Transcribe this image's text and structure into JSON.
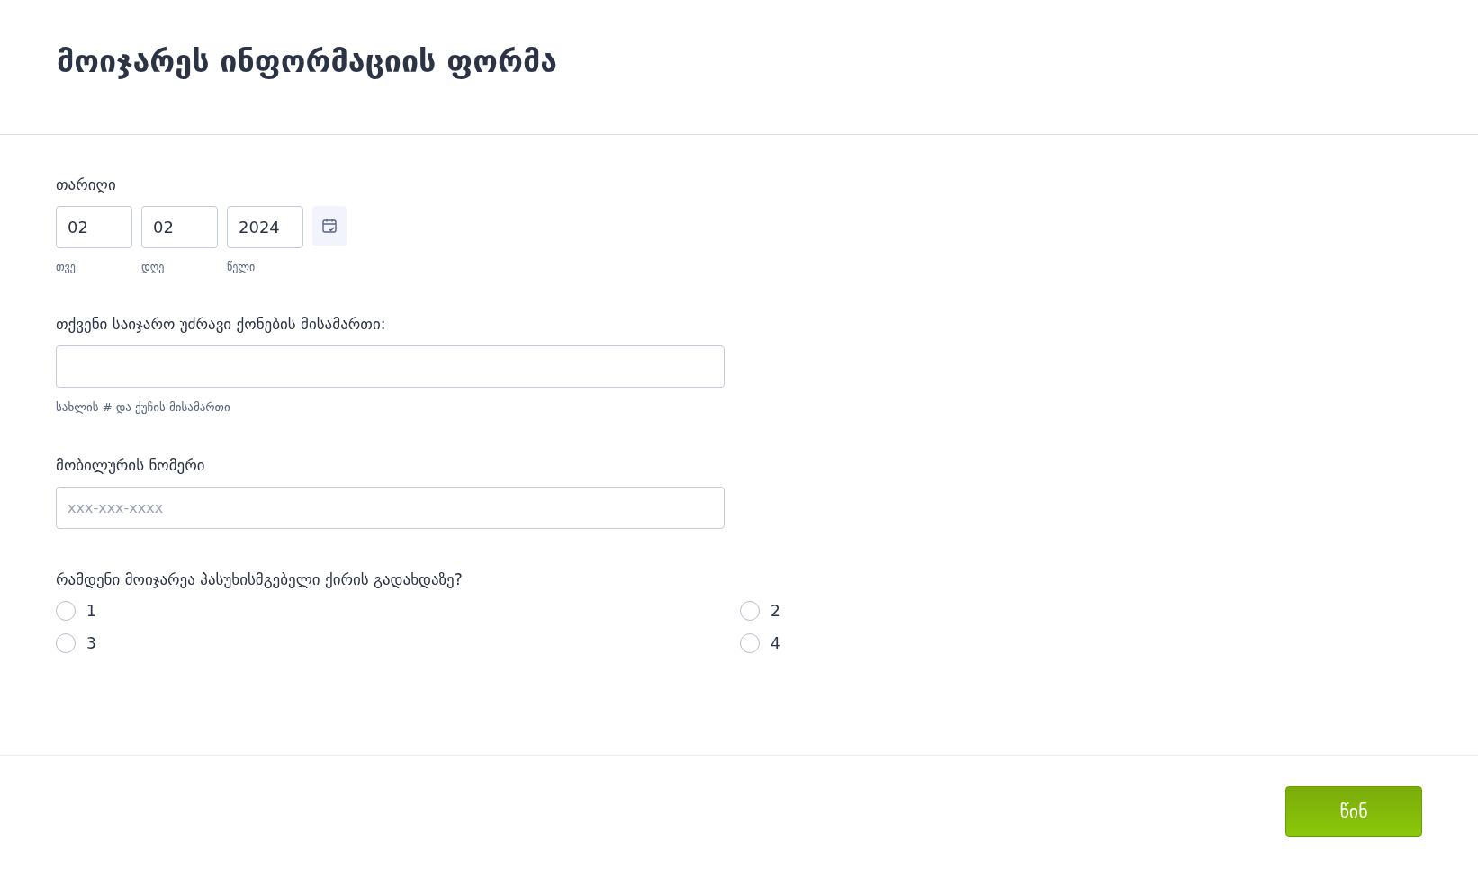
{
  "title": "მოიჯარეს ინფორმაციის ფორმა",
  "date": {
    "label": "თარიღი",
    "fields": [
      {
        "value": "02",
        "sublabel": "თვე"
      },
      {
        "value": "02",
        "sublabel": "დღე"
      },
      {
        "value": "2024",
        "sublabel": "წელი"
      }
    ]
  },
  "address": {
    "label": "თქვენი საიჯარო უძრავი ქონების მისამართი:",
    "hint": "სახლის # და ქუჩის მისამართი"
  },
  "mobile": {
    "label": "მობილურის ნომერი",
    "placeholder": "xxx-xxx-xxxx"
  },
  "tenants": {
    "question": "რამდენი მოიჯარეა პასუხისმგებელი ქირის გადახდაზე?",
    "options": [
      {
        "label": "1",
        "selected": false
      },
      {
        "label": "2",
        "selected": false
      },
      {
        "label": "3",
        "selected": false
      },
      {
        "label": "4",
        "selected": false
      }
    ]
  },
  "next_button": "წინ"
}
